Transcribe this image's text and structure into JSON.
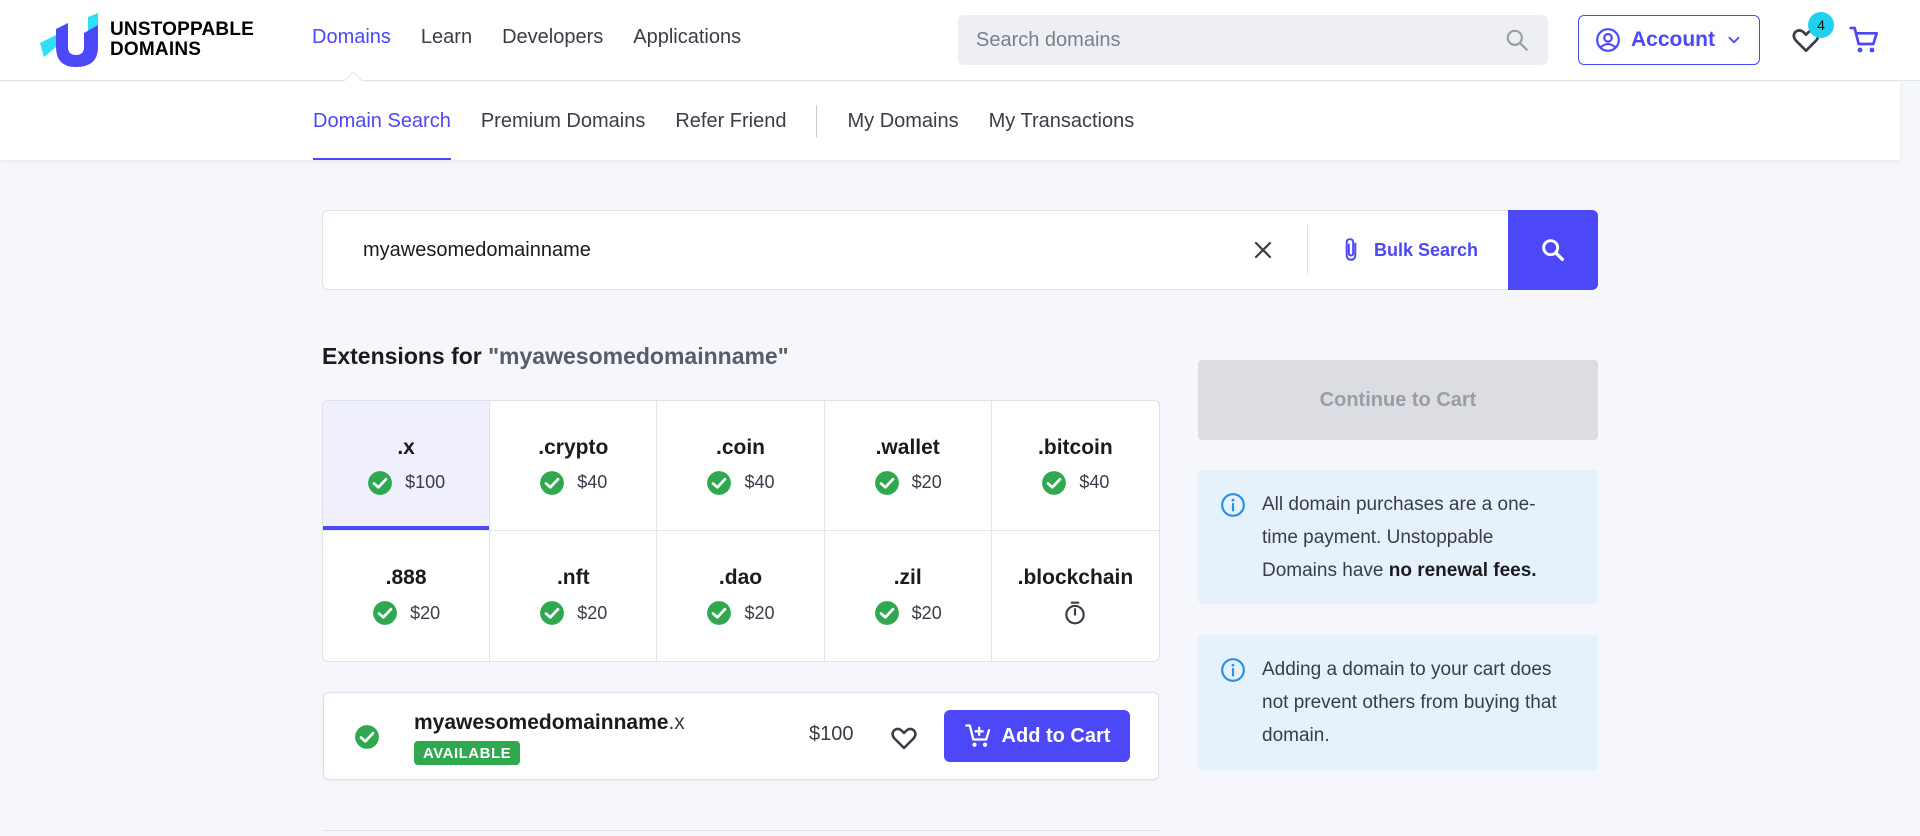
{
  "brand": {
    "line1": "UNSTOPPABLE",
    "line2": "DOMAINS",
    "logo_icon": "unstoppable-u-logo"
  },
  "nav": {
    "items": [
      {
        "label": "Domains",
        "active": true
      },
      {
        "label": "Learn"
      },
      {
        "label": "Developers"
      },
      {
        "label": "Applications"
      }
    ]
  },
  "top_search": {
    "placeholder": "Search domains",
    "icon": "search-icon"
  },
  "account": {
    "label": "Account",
    "icon": "user-circle-icon"
  },
  "favorites": {
    "count": "4",
    "icon": "heart-icon"
  },
  "cart": {
    "icon": "cart-icon"
  },
  "subnav": {
    "items": [
      {
        "label": "Domain Search",
        "active": true
      },
      {
        "label": "Premium Domains"
      },
      {
        "label": "Refer Friend"
      },
      {
        "label": "My Domains"
      },
      {
        "label": "My Transactions"
      }
    ]
  },
  "search": {
    "query": "myawesomedomainname",
    "bulk_label": "Bulk Search"
  },
  "extensions": {
    "title_prefix": "Extensions for ",
    "title_query": "\"myawesomedomainname\"",
    "items": [
      {
        "name": ".x",
        "price": "$100",
        "status": "available",
        "selected": true
      },
      {
        "name": ".crypto",
        "price": "$40",
        "status": "available"
      },
      {
        "name": ".coin",
        "price": "$40",
        "status": "available"
      },
      {
        "name": ".wallet",
        "price": "$20",
        "status": "available"
      },
      {
        "name": ".bitcoin",
        "price": "$40",
        "status": "available"
      },
      {
        "name": ".888",
        "price": "$20",
        "status": "available"
      },
      {
        "name": ".nft",
        "price": "$20",
        "status": "available"
      },
      {
        "name": ".dao",
        "price": "$20",
        "status": "available"
      },
      {
        "name": ".zil",
        "price": "$20",
        "status": "available"
      },
      {
        "name": ".blockchain",
        "price": "",
        "status": "pending"
      }
    ]
  },
  "result": {
    "name": "myawesomedomainname",
    "ext": ".x",
    "badge": "AVAILABLE",
    "price": "$100",
    "add_label": "Add to Cart"
  },
  "sidebar": {
    "continue_label": "Continue to Cart",
    "info1": {
      "text": "All domain purchases are a one-time payment. Unstoppable Domains have ",
      "bold": "no renewal fees."
    },
    "info2": {
      "text": "Adding a domain to your cart does not prevent others from buying that domain."
    }
  },
  "colors": {
    "accent": "#4c47f7",
    "success": "#2fa84f",
    "info_bg": "#e5f2fb",
    "badge": "#1fd1ec"
  }
}
